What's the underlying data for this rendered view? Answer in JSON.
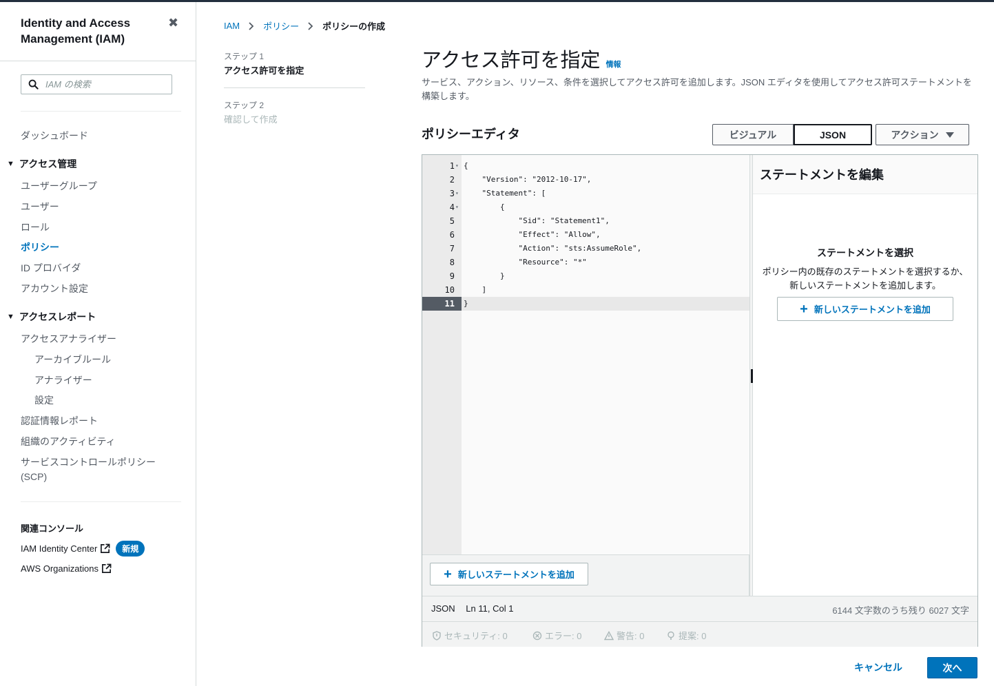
{
  "sidebar": {
    "title": "Identity and Access Management (IAM)",
    "search_placeholder": "IAM の検索",
    "dashboard": "ダッシュボード",
    "access_management": {
      "label": "アクセス管理",
      "items": [
        "ユーザーグループ",
        "ユーザー",
        "ロール",
        "ポリシー",
        "ID プロバイダ",
        "アカウント設定"
      ],
      "active": "ポリシー"
    },
    "access_reports": {
      "label": "アクセスレポート",
      "analyzer": "アクセスアナライザー",
      "analyzer_items": [
        "アーカイブルール",
        "アナライザー",
        "設定"
      ],
      "items": [
        "認証情報レポート",
        "組織のアクティビティ",
        "サービスコントロールポリシー",
        "(SCP)"
      ]
    },
    "related": {
      "label": "関連コンソール",
      "identity_center": "IAM Identity Center",
      "new_badge": "新規",
      "organizations": "AWS Organizations"
    }
  },
  "breadcrumb": {
    "iam": "IAM",
    "policies": "ポリシー",
    "current": "ポリシーの作成"
  },
  "steps": {
    "step1_label": "ステップ 1",
    "step1_title": "アクセス許可を指定",
    "step2_label": "ステップ 2",
    "step2_title": "確認して作成"
  },
  "main": {
    "title": "アクセス許可を指定",
    "info": "情報",
    "description": "サービス、アクション、リソース、条件を選択してアクセス許可を追加します。JSON エディタを使用してアクセス許可ステートメントを構築します。",
    "editor_title": "ポリシーエディタ",
    "visual_tab": "ビジュアル",
    "json_tab": "JSON",
    "actions_button": "アクション"
  },
  "editor": {
    "lines": [
      {
        "n": "1",
        "fold": true,
        "text": "{"
      },
      {
        "n": "2",
        "fold": false,
        "text": "    \"Version\": \"2012-10-17\","
      },
      {
        "n": "3",
        "fold": true,
        "text": "    \"Statement\": ["
      },
      {
        "n": "4",
        "fold": true,
        "text": "        {"
      },
      {
        "n": "5",
        "fold": false,
        "text": "            \"Sid\": \"Statement1\","
      },
      {
        "n": "6",
        "fold": false,
        "text": "            \"Effect\": \"Allow\","
      },
      {
        "n": "7",
        "fold": false,
        "text": "            \"Action\": \"sts:AssumeRole\","
      },
      {
        "n": "8",
        "fold": false,
        "text": "            \"Resource\": \"*\""
      },
      {
        "n": "9",
        "fold": false,
        "text": "        }"
      },
      {
        "n": "10",
        "fold": false,
        "text": "    ]"
      },
      {
        "n": "11",
        "fold": false,
        "text": "}"
      }
    ],
    "active_line": "11",
    "add_statement": "新しいステートメントを追加",
    "status_mode": "JSON",
    "status_pos": "Ln 11, Col 1",
    "status_remaining": "6144 文字数のうち残り 6027 文字",
    "security": "セキュリティ: 0",
    "errors": "エラー: 0",
    "warnings": "警告: 0",
    "suggestions": "提案: 0"
  },
  "statement_panel": {
    "title": "ステートメントを編集",
    "select_title": "ステートメントを選択",
    "select_desc": "ポリシー内の既存のステートメントを選択するか、新しいステートメントを追加します。",
    "add_statement": "新しいステートメントを追加"
  },
  "footer": {
    "cancel": "キャンセル",
    "next": "次へ"
  },
  "colors": {
    "link": "#0073bb",
    "primary": "#0073bb",
    "text": "#16191f",
    "muted": "#545b64"
  }
}
